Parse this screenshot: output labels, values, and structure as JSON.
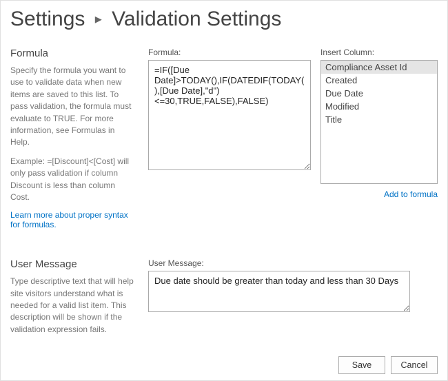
{
  "breadcrumb": {
    "root": "Settings",
    "current": "Validation Settings"
  },
  "formula_section": {
    "title": "Formula",
    "description": "Specify the formula you want to use to validate data when new items are saved to this list. To pass validation, the formula must evaluate to TRUE. For more information, see Formulas in Help.",
    "example": "Example: =[Discount]<[Cost] will only pass validation if column Discount is less than column Cost.",
    "link": "Learn more about proper syntax for formulas.",
    "label": "Formula:",
    "value": "=IF([Due Date]>TODAY(),IF(DATEDIF(TODAY(),[Due Date],\"d\")<=30,TRUE,FALSE),FALSE)",
    "insert_label": "Insert Column:",
    "columns": [
      "Compliance Asset Id",
      "Created",
      "Due Date",
      "Modified",
      "Title"
    ],
    "selected_index": 0,
    "add_link": "Add to formula"
  },
  "message_section": {
    "title": "User Message",
    "description": "Type descriptive text that will help site visitors understand what is needed for a valid list item. This description will be shown if the validation expression fails.",
    "label": "User Message:",
    "value": "Due date should be greater than today and less than 30 Days"
  },
  "actions": {
    "save": "Save",
    "cancel": "Cancel"
  }
}
